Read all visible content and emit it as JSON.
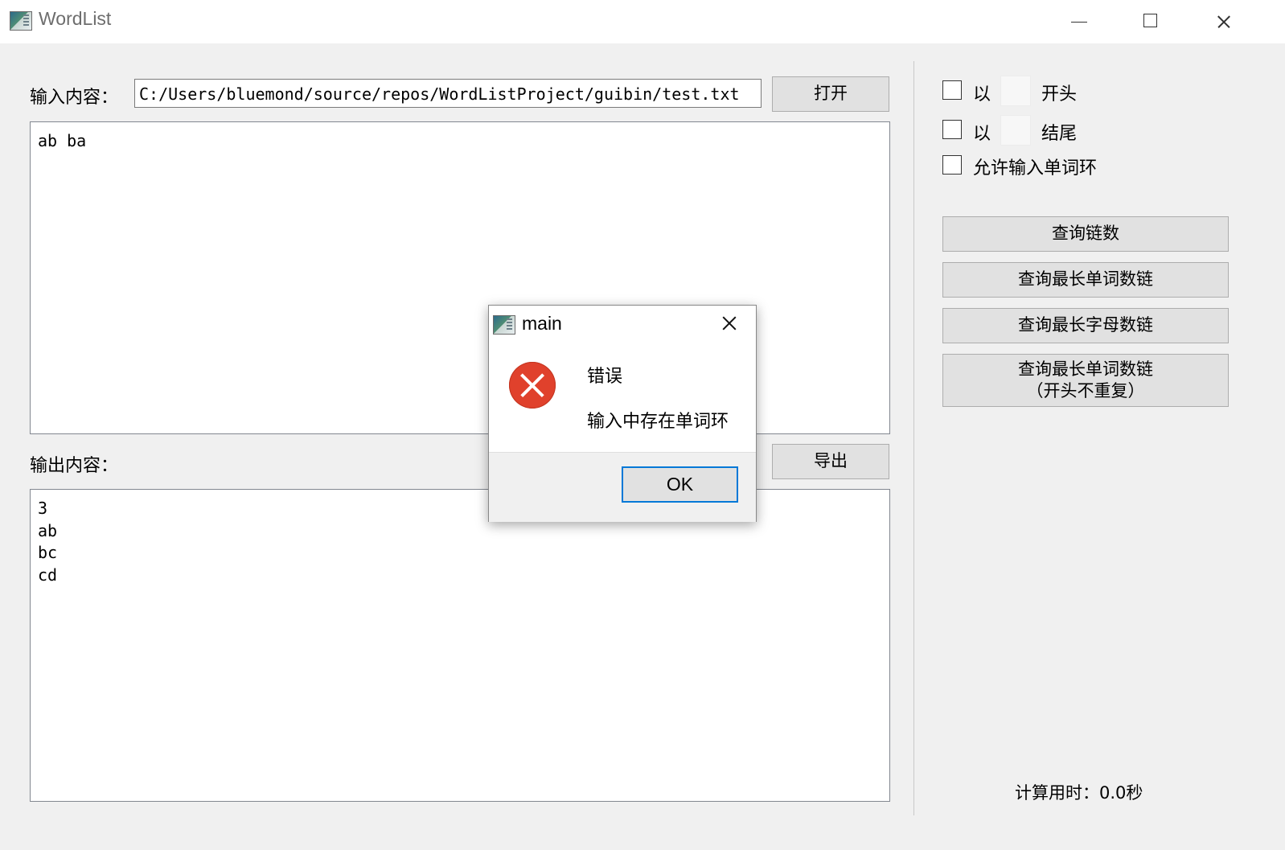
{
  "window": {
    "title": "WordList",
    "icon": "app-window-icon",
    "controls": [
      "minimize-icon",
      "maximize-icon",
      "close-icon"
    ]
  },
  "input_section": {
    "label": "输入内容：",
    "path_value": "C:/Users/bluemond/source/repos/WordListProject/guibin/test.txt",
    "open_button": "打开",
    "text": "ab ba"
  },
  "output_section": {
    "label": "输出内容：",
    "export_button": "导出",
    "text": "3\nab\nbc\ncd"
  },
  "options": {
    "start_prefix": "以",
    "start_char": "",
    "start_suffix": "开头",
    "end_prefix": "以",
    "end_char": "",
    "end_suffix": "结尾",
    "allow_cycle_label": "允许输入单词环",
    "start_checked": false,
    "end_checked": false,
    "allow_cycle_checked": false
  },
  "actions": {
    "count_chains": "查询链数",
    "longest_word_chain": "查询最长单词数链",
    "longest_letter_chain": "查询最长字母数链",
    "longest_word_chain_unique_line1": "查询最长单词数链",
    "longest_word_chain_unique_line2": "（开头不重复）"
  },
  "timing": "计算用时：0.0秒",
  "dialog": {
    "title": "main",
    "icon": "error-icon",
    "heading": "错误",
    "message": "输入中存在单词环",
    "ok_button": "OK"
  }
}
